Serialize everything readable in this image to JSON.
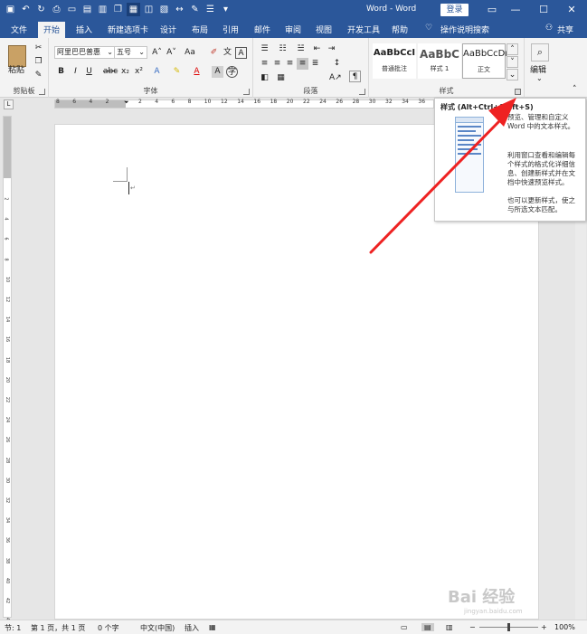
{
  "window": {
    "title": "Word - Word",
    "login": "登录",
    "minimize": "—",
    "maximize": "☐",
    "close": "✕"
  },
  "tabs": [
    "文件",
    "开始",
    "插入",
    "新建选项卡",
    "设计",
    "布局",
    "引用",
    "邮件",
    "审阅",
    "视图",
    "开发工具",
    "帮助"
  ],
  "search_label": "操作说明搜索",
  "share_label": "共享",
  "clipboard": {
    "paste": "粘贴",
    "group": "剪贴板"
  },
  "font": {
    "name": "阿里巴巴普惠",
    "size": "五号",
    "group": "字体"
  },
  "paragraph": {
    "group": "段落"
  },
  "styles": {
    "group": "样式",
    "items": [
      {
        "preview": "AaBbCcI",
        "name": "普通批注"
      },
      {
        "preview": "AaBbC",
        "name": "样式 1"
      },
      {
        "preview": "AaBbCcDı",
        "name": "正文"
      }
    ]
  },
  "editing": {
    "label": "编辑"
  },
  "tooltip": {
    "title": "样式 (Alt+Ctrl+Shift+S)",
    "p1": "预览、管理和自定义 Word 中的文本样式。",
    "p2": "利用窗口查看和编辑每个样式的格式化详细信息、创建新样式并在文档中快速预览样式。",
    "p3": "也可以更新样式，使之与所选文本匹配。"
  },
  "ruler_h": [
    "8",
    "6",
    "4",
    "2",
    "",
    "2",
    "4",
    "6",
    "8",
    "10",
    "12",
    "14",
    "16",
    "18",
    "20",
    "22",
    "24",
    "26",
    "28",
    "30",
    "32",
    "34",
    "36"
  ],
  "ruler_v": [
    "2",
    "4",
    "6",
    "8",
    "10",
    "12",
    "14",
    "16",
    "18",
    "20",
    "22",
    "24",
    "26",
    "28",
    "30",
    "32",
    "34",
    "36",
    "38",
    "40",
    "42",
    "44"
  ],
  "status": {
    "page": "节: 1",
    "pages": "第 1 页，共 1 页",
    "words": "0 个字",
    "lang": "中文(中国)",
    "mode": "插入",
    "zoom": "100%"
  },
  "watermark": {
    "text": "Bai 经验",
    "sub": "jingyan.baidu.com"
  }
}
